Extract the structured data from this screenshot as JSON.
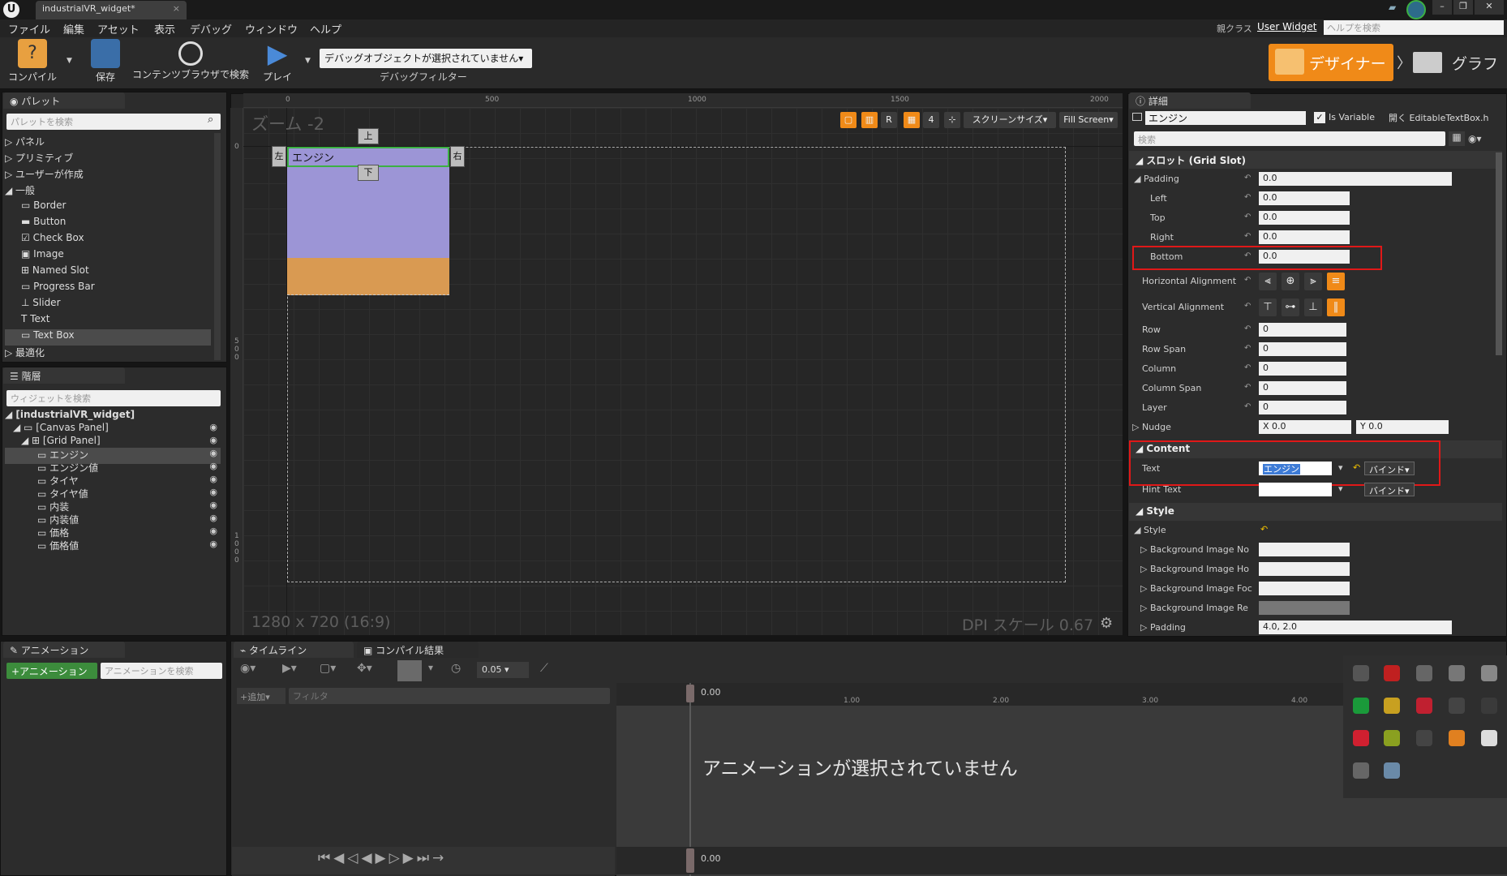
{
  "titlebar": {
    "tab_title": "industrialVR_widget*",
    "tab_close": "×",
    "logo": "U",
    "help_search_placeholder": "ヘルプを検索"
  },
  "menu": {
    "items": [
      "ファイル",
      "編集",
      "アセット",
      "表示",
      "デバッグ",
      "ウィンドウ",
      "ヘルプ"
    ],
    "parent_class_label": "親クラス",
    "parent_class_value": "User Widget"
  },
  "toolbar": {
    "compile": "コンパイル",
    "save": "保存",
    "browse": "コンテンツブラウザで検索",
    "play": "プレイ",
    "debug_select": "デバッグオブジェクトが選択されていません▾",
    "debug_filter": "デバッグフィルター",
    "designer": "デザイナー",
    "graph": "グラフ"
  },
  "palette": {
    "tab": "パレット",
    "search_placeholder": "パレットを検索",
    "categories": [
      {
        "label": "パネル",
        "expanded": false
      },
      {
        "label": "プリミティブ",
        "expanded": false
      },
      {
        "label": "ユーザーが作成",
        "expanded": false
      },
      {
        "label": "一般",
        "expanded": true
      }
    ],
    "items": [
      "Border",
      "Button",
      "Check Box",
      "Image",
      "Named Slot",
      "Progress Bar",
      "Slider",
      "Text",
      "Text Box"
    ],
    "selected": "Text Box",
    "last_category": "最適化"
  },
  "hierarchy": {
    "tab": "階層",
    "search_placeholder": "ウィジェットを検索",
    "root": "[industrialVR_widget]",
    "canvas": "[Canvas Panel]",
    "grid": "[Grid Panel]",
    "children": [
      "エンジン",
      "エンジン値",
      "タイヤ",
      "タイヤ値",
      "内装",
      "内装値",
      "価格",
      "価格値"
    ],
    "selected": "エンジン"
  },
  "canvas": {
    "zoom": "ズーム -2",
    "resolution": "1280 x 720 (16:9)",
    "dpi": "DPI スケール 0.67",
    "screen_size": "スクリーンサイズ▾",
    "fill_screen": "Fill Screen▾",
    "ruler_top": [
      "0",
      "500",
      "1000",
      "1500",
      "2000"
    ],
    "ruler_left": [
      "0",
      "5 0 0",
      "1 0 0 0"
    ],
    "anchor_top": "上",
    "anchor_bottom": "下",
    "anchor_left": "左",
    "anchor_right": "右",
    "widget_text": "エンジン",
    "tool_r": "R",
    "tool_4": "4"
  },
  "details": {
    "tab": "詳細",
    "name_value": "エンジン",
    "is_variable": "Is Variable",
    "open_file": "開く EditableTextBox.h",
    "search_placeholder": "検索",
    "slot_section": "スロット (Grid Slot)",
    "padding_label": "Padding",
    "padding_value": "0.0",
    "left_label": "Left",
    "left_value": "0.0",
    "top_label": "Top",
    "top_value": "0.0",
    "right_label": "Right",
    "right_value": "0.0",
    "bottom_label": "Bottom",
    "bottom_value": "0.0",
    "halign_label": "Horizontal Alignment",
    "valign_label": "Vertical Alignment",
    "row_label": "Row",
    "row_value": "0",
    "rowspan_label": "Row Span",
    "rowspan_value": "0",
    "column_label": "Column",
    "column_value": "0",
    "colspan_label": "Column Span",
    "colspan_value": "0",
    "layer_label": "Layer",
    "layer_value": "0",
    "nudge_label": "Nudge",
    "nudge_x": "X 0.0",
    "nudge_y": "Y 0.0",
    "content_section": "Content",
    "text_label": "Text",
    "text_value": "エンジン",
    "bind": "バインド▾",
    "hint_label": "Hint Text",
    "style_section": "Style",
    "style_label": "Style",
    "bg_normal": "Background Image No",
    "bg_hover": "Background Image Ho",
    "bg_focus": "Background Image Foc",
    "bg_readonly": "Background Image Re",
    "style_padding_label": "Padding",
    "style_padding_value": "4.0, 2.0"
  },
  "animation": {
    "tab": "アニメーション",
    "add_button": "+アニメーション",
    "search_placeholder": "アニメーションを検索"
  },
  "timeline": {
    "tab": "タイムライン",
    "compile_tab": "コンパイル結果",
    "add": "+追加▾",
    "filter_placeholder": "フィルタ",
    "snap_value": "0.05",
    "time_labels": [
      "0.00",
      "1.00",
      "2.00",
      "3.00",
      "4.00"
    ],
    "bottom_time": "0.00",
    "no_animation": "アニメーションが選択されていません"
  },
  "colors": {
    "accent": "#f08a18",
    "selection_green": "#3cb043",
    "highlight_red": "#e01818",
    "widget_purple": "#9c95d6",
    "widget_orange": "#d99a52"
  }
}
